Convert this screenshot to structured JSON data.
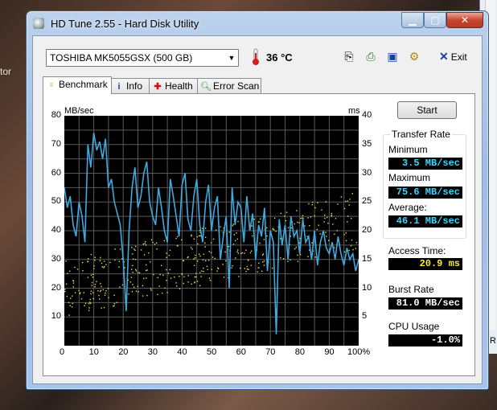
{
  "desktop": {
    "fragment": "tor"
  },
  "bg_window": {
    "fragment": "R"
  },
  "window": {
    "title": "HD Tune 2.55 - Hard Disk Utility"
  },
  "toolbar": {
    "drive": "TOSHIBA MK5055GSX (500 GB)",
    "temperature": "36 °C",
    "exit_label": "Exit"
  },
  "tabs": [
    {
      "label": "Benchmark",
      "icon": "benchmark-icon"
    },
    {
      "label": "Info",
      "icon": "info-icon"
    },
    {
      "label": "Health",
      "icon": "health-icon"
    },
    {
      "label": "Error Scan",
      "icon": "error-scan-icon"
    }
  ],
  "benchmark": {
    "start_label": "Start",
    "transfer_rate_label": "Transfer Rate",
    "minimum_label": "Minimum",
    "minimum": "3.5 MB/sec",
    "maximum_label": "Maximum",
    "maximum": "75.6 MB/sec",
    "average_label": "Average:",
    "average": "46.1 MB/sec",
    "access_time_label": "Access Time:",
    "access_time": "20.9 ms",
    "burst_rate_label": "Burst Rate",
    "burst_rate": "81.0 MB/sec",
    "cpu_usage_label": "CPU Usage",
    "cpu_usage": "-1.0%"
  },
  "colors": {
    "transfer_line": "#3fa9e0",
    "access_dots": "#e8e04a",
    "value_cyan": "#3ad6ff",
    "value_yellow": "#f4ee30",
    "value_white": "#ffffff"
  },
  "chart_data": {
    "type": "line",
    "xlabel": "",
    "ylabel": "MB/sec",
    "y2label": "ms",
    "xlim": [
      0,
      100
    ],
    "ylim": [
      0,
      80
    ],
    "y2lim": [
      0,
      40
    ],
    "x_ticks": [
      "0",
      "10",
      "20",
      "30",
      "40",
      "50",
      "60",
      "70",
      "80",
      "90",
      "100%"
    ],
    "y_ticks": [
      "10",
      "20",
      "30",
      "40",
      "50",
      "60",
      "70",
      "80"
    ],
    "y2_ticks": [
      "5",
      "10",
      "15",
      "20",
      "25",
      "30",
      "35",
      "40"
    ],
    "grid": true,
    "series": [
      {
        "name": "",
        "x": [
          0,
          1,
          2,
          3,
          4,
          5,
          6,
          7,
          8,
          9,
          10,
          11,
          12,
          13,
          14,
          15,
          16,
          17,
          18,
          19,
          20,
          21,
          22,
          23,
          24,
          25,
          26,
          27,
          28,
          29,
          30,
          31,
          32,
          33,
          34,
          35,
          36,
          37,
          38,
          39,
          40,
          41,
          42,
          43,
          44,
          45,
          46,
          47,
          48,
          49,
          50,
          51,
          52,
          53,
          54,
          55,
          56,
          57,
          58,
          59,
          60,
          61,
          62,
          63,
          64,
          65,
          66,
          67,
          68,
          69,
          70,
          71,
          72,
          73,
          74,
          75,
          76,
          77,
          78,
          79,
          80,
          81,
          82,
          83,
          84,
          85,
          86,
          87,
          88,
          89,
          90,
          91,
          92,
          93,
          94,
          95,
          96,
          97,
          98,
          99,
          100
        ],
        "values": [
          55,
          48,
          52,
          42,
          38,
          50,
          45,
          36,
          70,
          62,
          74,
          68,
          71,
          65,
          72,
          55,
          58,
          50,
          46,
          42,
          30,
          12,
          40,
          55,
          62,
          48,
          52,
          60,
          64,
          50,
          45,
          42,
          55,
          48,
          40,
          36,
          58,
          52,
          45,
          38,
          56,
          60,
          44,
          40,
          52,
          58,
          42,
          36,
          50,
          56,
          40,
          48,
          52,
          30,
          38,
          45,
          20,
          55,
          42,
          50,
          48,
          36,
          52,
          40,
          46,
          30,
          42,
          38,
          48,
          26,
          40,
          36,
          4,
          44,
          35,
          42,
          30,
          45,
          38,
          40,
          32,
          44,
          36,
          38,
          30,
          40,
          28,
          36,
          40,
          34,
          32,
          36,
          30,
          38,
          32,
          28,
          34,
          30,
          32,
          26,
          30
        ]
      }
    ]
  }
}
